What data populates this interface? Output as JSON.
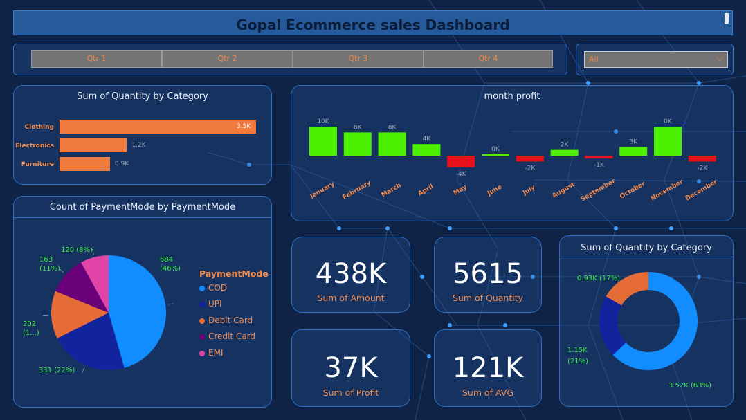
{
  "header": {
    "title": "Gopal Ecommerce sales Dashboard"
  },
  "slicer": {
    "quarters": [
      "Qtr 1",
      "Qtr 2",
      "Qtr 3",
      "Qtr 4"
    ],
    "dropdown_value": "All"
  },
  "category_bar": {
    "title": "Sum of Quantity by Category",
    "bar_color": "#f07a3c",
    "categories": [
      "Clothing",
      "Electronics",
      "Furniture"
    ],
    "values": [
      3500,
      1200,
      900
    ],
    "labels": [
      "3.5K",
      "1.2K",
      "0.9K"
    ]
  },
  "month_profit": {
    "title": "month profit",
    "positive_color": "#4cf000",
    "negative_color": "#e8101a",
    "months": [
      "January",
      "February",
      "March",
      "April",
      "May",
      "June",
      "July",
      "August",
      "September",
      "October",
      "November",
      "December"
    ],
    "values": [
      10,
      8,
      8,
      4,
      -4,
      0,
      -2,
      2,
      -1,
      3,
      10,
      -2
    ],
    "labels": [
      "10K",
      "8K",
      "8K",
      "4K",
      "-4K",
      "0K",
      "-2K",
      "2K",
      "-1K",
      "3K",
      "0K",
      "-2K"
    ]
  },
  "payment_pie": {
    "title": "Count of PaymentMode by PaymentMode",
    "legend_title": "PaymentMode",
    "items": [
      {
        "name": "COD",
        "value": 684,
        "label": "684 (46%)",
        "color": "#118dff"
      },
      {
        "name": "UPI",
        "value": 331,
        "label": "331 (22%)",
        "color": "#12239e"
      },
      {
        "name": "Debit Card",
        "value": 202,
        "label": "202 (1...)",
        "color": "#e66c37"
      },
      {
        "name": "Credit Card",
        "value": 163,
        "label": "163 (11%)",
        "color": "#6b007b"
      },
      {
        "name": "EMI",
        "value": 120,
        "label": "120 (8%)",
        "color": "#e044a7"
      }
    ]
  },
  "kpis": {
    "amount": {
      "value": "438K",
      "label": "Sum of Amount"
    },
    "quantity": {
      "value": "5615",
      "label": "Sum of Quantity"
    },
    "profit": {
      "value": "37K",
      "label": "Sum of Profit"
    },
    "avg": {
      "value": "121K",
      "label": "Sum of AVG"
    }
  },
  "category_donut": {
    "title": "Sum of Quantity by Category",
    "items": [
      {
        "name": "Clothing",
        "value": 3520,
        "label": "3.52K (63%)",
        "color": "#118dff"
      },
      {
        "name": "Electronics",
        "value": 1150,
        "label": "1.15K (21%)",
        "color": "#12239e"
      },
      {
        "name": "Furniture",
        "value": 930,
        "label": "0.93K (17%)",
        "color": "#e66c37"
      }
    ]
  },
  "chart_data": [
    {
      "type": "bar",
      "title": "Sum of Quantity by Category",
      "categories": [
        "Clothing",
        "Electronics",
        "Furniture"
      ],
      "values": [
        3500,
        1200,
        900
      ]
    },
    {
      "type": "bar",
      "title": "month profit",
      "categories": [
        "January",
        "February",
        "March",
        "April",
        "May",
        "June",
        "July",
        "August",
        "September",
        "October",
        "November",
        "December"
      ],
      "values": [
        10,
        8,
        8,
        4,
        -4,
        0,
        -2,
        2,
        -1,
        3,
        10,
        -2
      ]
    },
    {
      "type": "pie",
      "title": "Count of PaymentMode by PaymentMode",
      "categories": [
        "COD",
        "UPI",
        "Debit Card",
        "Credit Card",
        "EMI"
      ],
      "values": [
        684,
        331,
        202,
        163,
        120
      ]
    },
    {
      "type": "pie",
      "title": "Sum of Quantity by Category",
      "categories": [
        "Clothing",
        "Electronics",
        "Furniture"
      ],
      "values": [
        3520,
        1150,
        930
      ]
    }
  ]
}
